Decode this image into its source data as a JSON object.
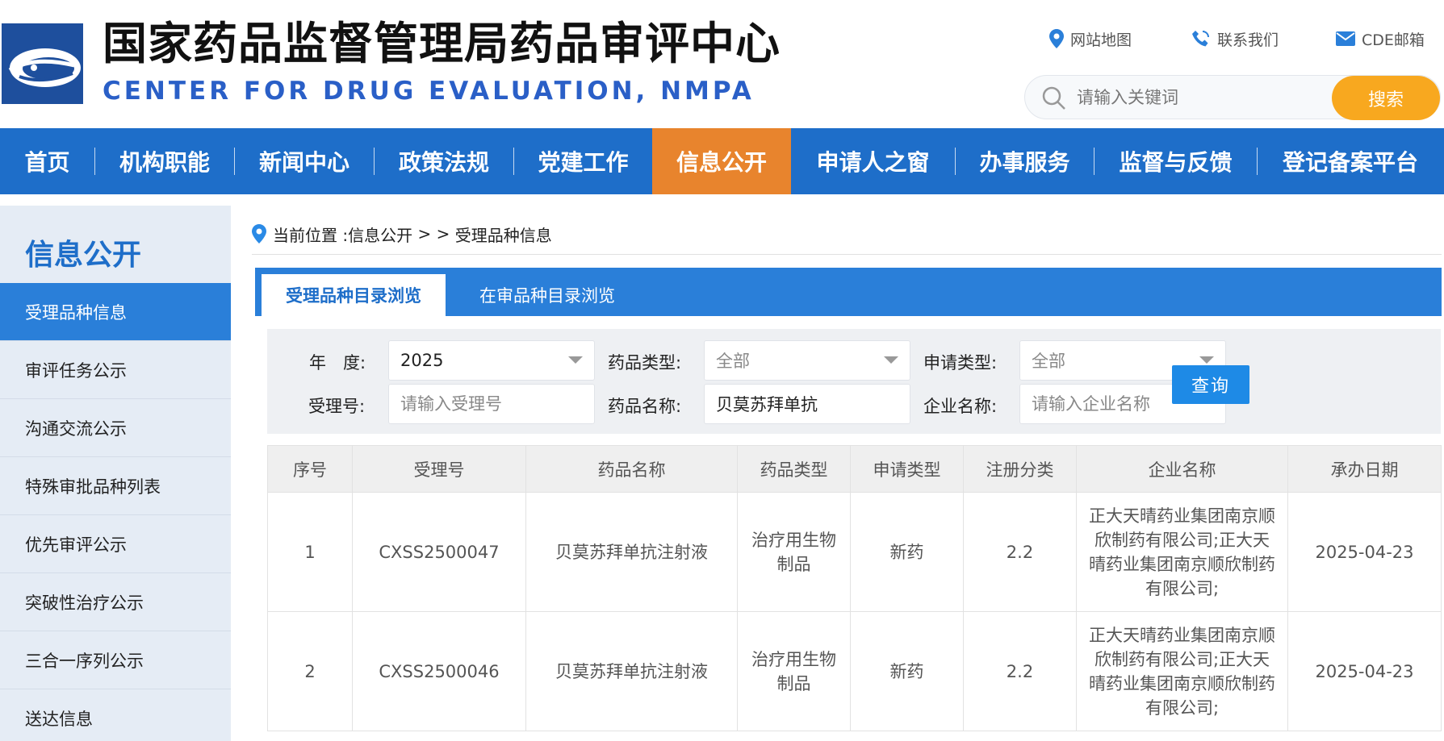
{
  "header": {
    "title_cn": "国家药品监督管理局药品审评中心",
    "title_en": "CENTER FOR DRUG EVALUATION, NMPA",
    "top_links": [
      {
        "label": "网站地图",
        "icon": "map-pin-icon"
      },
      {
        "label": "联系我们",
        "icon": "phone-icon"
      },
      {
        "label": "CDE邮箱",
        "icon": "mail-icon"
      }
    ],
    "search": {
      "placeholder": "请输入关键词",
      "button": "搜索"
    }
  },
  "nav": {
    "items": [
      {
        "label": "首页"
      },
      {
        "label": "机构职能"
      },
      {
        "label": "新闻中心"
      },
      {
        "label": "政策法规"
      },
      {
        "label": "党建工作"
      },
      {
        "label": "信息公开",
        "active": true
      },
      {
        "label": "申请人之窗"
      },
      {
        "label": "办事服务"
      },
      {
        "label": "监督与反馈"
      },
      {
        "label": "登记备案平台"
      }
    ]
  },
  "sidebar": {
    "title": "信息公开",
    "items": [
      {
        "label": "受理品种信息",
        "active": true
      },
      {
        "label": "审评任务公示"
      },
      {
        "label": "沟通交流公示"
      },
      {
        "label": "特殊审批品种列表"
      },
      {
        "label": "优先审评公示"
      },
      {
        "label": "突破性治疗公示"
      },
      {
        "label": "三合一序列公示"
      },
      {
        "label": "送达信息"
      }
    ]
  },
  "breadcrumb": {
    "prefix": "当前位置 : ",
    "section": "信息公开",
    "separator": " > > ",
    "current": "受理品种信息"
  },
  "tabs": [
    {
      "label": "受理品种目录浏览",
      "active": true
    },
    {
      "label": "在审品种目录浏览"
    }
  ],
  "filters": {
    "year_label": "年　度:",
    "year_value": "2025",
    "drug_type_label": "药品类型:",
    "drug_type_value": "全部",
    "apply_type_label": "申请类型:",
    "apply_type_value": "全部",
    "accept_no_label": "受理号:",
    "accept_no_placeholder": "请输入受理号",
    "drug_name_label": "药品名称:",
    "drug_name_value": "贝莫苏拜单抗",
    "company_label": "企业名称:",
    "company_placeholder": "请输入企业名称",
    "query_button": "查询"
  },
  "table": {
    "headers": [
      "序号",
      "受理号",
      "药品名称",
      "药品类型",
      "申请类型",
      "注册分类",
      "企业名称",
      "承办日期"
    ],
    "rows": [
      [
        "1",
        "CXSS2500047",
        "贝莫苏拜单抗注射液",
        "治疗用生物制品",
        "新药",
        "2.2",
        "正大天晴药业集团南京顺欣制药有限公司;正大天晴药业集团南京顺欣制药有限公司;",
        "2025-04-23"
      ],
      [
        "2",
        "CXSS2500046",
        "贝莫苏拜单抗注射液",
        "治疗用生物制品",
        "新药",
        "2.2",
        "正大天晴药业集团南京顺欣制药有限公司;正大天晴药业集团南京顺欣制药有限公司;",
        "2025-04-23"
      ]
    ]
  },
  "colors": {
    "nav_blue": "#1e6ec9",
    "nav_active": "#e8842d",
    "search_button": "#f8a81f",
    "tab_blue": "#2a7fd9",
    "query_button": "#1e8ae6"
  }
}
